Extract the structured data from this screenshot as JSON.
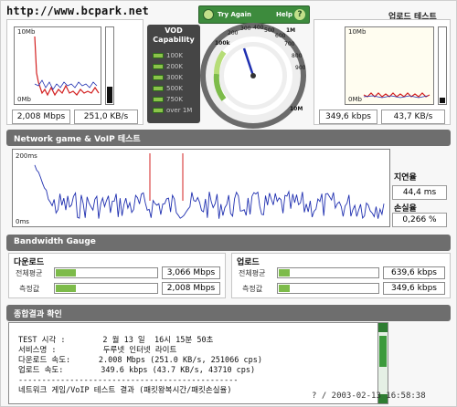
{
  "watermark": "http://www.bcpark.net",
  "upload_test_title": "업로드 테스트",
  "download_chart": {
    "ymax": "10Mb",
    "ymin": "0Mb"
  },
  "upload_chart": {
    "ymax": "10Mb",
    "ymin": "0Mb"
  },
  "download_values": {
    "mbps": "2,008 Mbps",
    "kbs": "251,0 KB/s"
  },
  "upload_values": {
    "kbps": "349,6 kbps",
    "kbs": "43,7 KB/s"
  },
  "vod": {
    "title_line1": "VOD",
    "title_line2": "Capability",
    "items": [
      "100K",
      "200K",
      "300K",
      "500K",
      "750K",
      "over 1M"
    ],
    "active_count": 6,
    "led_color": "#8bc34a"
  },
  "gauge": {
    "try_again": "Try Again",
    "help": "Help",
    "help_icon": "?",
    "scale": [
      "100k",
      "200",
      "300",
      "400",
      "500",
      "600",
      "700",
      "800",
      "900",
      "1M",
      "10M"
    ],
    "speed_fraction": 0.33
  },
  "network": {
    "title": "Network game & VoIP 테스트",
    "ymax": "200ms",
    "ymin": "0ms",
    "latency_label": "지연율",
    "latency_value": "44,4 ms",
    "loss_label": "손실율",
    "loss_value": "0,266 %"
  },
  "bandwidth": {
    "title": "Bandwidth Gauge",
    "download_title": "다운로드",
    "upload_title": "업로드",
    "avg_label": "전체평균",
    "measured_label": "측정값",
    "download_avg": "3,066 Mbps",
    "download_measured": "2,008 Mbps",
    "upload_avg": "639,6 kbps",
    "upload_measured": "349,6 kbps",
    "download_avg_fraction": 0.2,
    "download_measured_fraction": 0.2,
    "upload_avg_fraction": 0.1,
    "upload_measured_fraction": 0.1
  },
  "results": {
    "title": "종합결과 확인",
    "lines": [
      "TEST 시각 :        2 월 13 일  16시 15분 50초",
      "서비스명 :          두루넷 인터넷 라이트",
      "다운로드 속도:      2.008 Mbps (251.0 KB/s, 251066 cps)",
      "업로드 속도:        349.6 kbps (43.7 KB/s, 43710 cps)",
      "-----------------------------------------------",
      "네트워크 게임/VoIP 테스트 결과 (패킷왕복시간/패킷손실율)"
    ]
  },
  "timestamp": "? / 2003-02-13 16:58:38",
  "colors": {
    "accent_green": "#3d8b3d",
    "bar_grey": "#6e6e6e",
    "line_blue": "#1f2fb0",
    "spike_red": "#d32020"
  }
}
